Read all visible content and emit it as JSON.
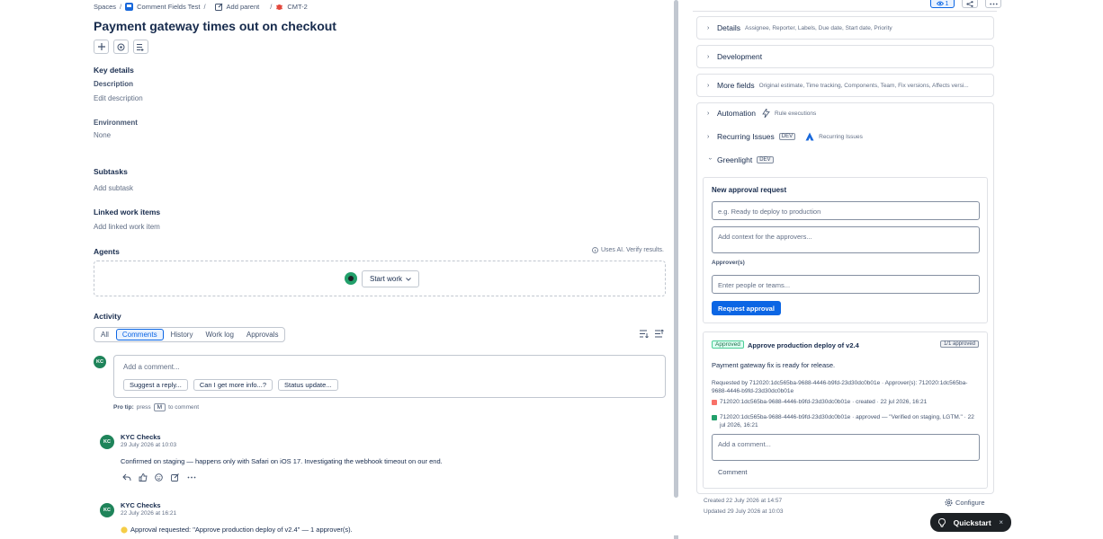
{
  "breadcrumbs": {
    "spaces": "Spaces",
    "project": "Comment Fields Test",
    "add_parent": "Add parent",
    "issue_key": "CMT-2",
    "sep": "/"
  },
  "issue": {
    "title": "Payment gateway times out on checkout"
  },
  "key_details": {
    "heading": "Key details",
    "description_label": "Description",
    "description_value": "Edit description",
    "environment_label": "Environment",
    "environment_value": "None"
  },
  "subtasks": {
    "heading": "Subtasks",
    "action": "Add subtask"
  },
  "linked": {
    "heading": "Linked work items",
    "action": "Add linked work item"
  },
  "agents": {
    "heading": "Agents",
    "ai_note": "Uses AI. Verify results.",
    "start_work": "Start work"
  },
  "activity": {
    "heading": "Activity",
    "tabs": [
      "All",
      "Comments",
      "History",
      "Work log",
      "Approvals"
    ],
    "active_tab": "Comments",
    "comment_placeholder": "Add a comment...",
    "suggestions": [
      "Suggest a reply...",
      "Can I get more info...?",
      "Status update..."
    ],
    "protip_bold": "Pro tip:",
    "protip_press": "press",
    "protip_key": "M",
    "protip_rest": "to comment",
    "current_user_initials": "KC",
    "comments": [
      {
        "initials": "KC",
        "author": "KYC Checks",
        "date": "29 July 2026 at 10:03",
        "body": "Confirmed on staging — happens only with Safari on iOS 17. Investigating the webhook timeout on our end."
      },
      {
        "initials": "KC",
        "author": "KYC Checks",
        "date": "22 July 2026 at 16:21",
        "body": "Approval requested: \"Approve production deploy of v2.4\" — 1 approver(s)."
      }
    ]
  },
  "top_actions": {
    "watch_count": "1"
  },
  "panels": {
    "details": {
      "title": "Details",
      "sub": "Assignee, Reporter, Labels, Due date, Start date, Priority"
    },
    "development": {
      "title": "Development"
    },
    "more_fields": {
      "title": "More fields",
      "sub": "Original estimate, Time tracking, Components, Team, Fix versions, Affects versi..."
    },
    "automation": {
      "title": "Automation",
      "sub": "Rule executions"
    },
    "recurring": {
      "title": "Recurring Issues",
      "badge": "DEV",
      "sub": "Recurring Issues"
    },
    "greenlight": {
      "title": "Greenlight",
      "badge": "DEV"
    }
  },
  "greenlight": {
    "new_request_heading": "New approval request",
    "title_placeholder": "e.g. Ready to deploy to production",
    "context_placeholder": "Add context for the approvers...",
    "approvers_label": "Approver(s)",
    "approvers_placeholder": "Enter people or teams...",
    "request_button": "Request approval",
    "request": {
      "status": "Approved",
      "title": "Approve production deploy of v2.4",
      "count": "1/1 approved",
      "description": "Payment gateway fix is ready for release.",
      "requested_by": "Requested by 712020:1dc565ba-9688-4446-b9fd-23d30dc0b01e · Approver(s): 712020:1dc565ba-9688-4446-b9fd-23d30dc0b01e",
      "log_created": "712020:1dc565ba-9688-4446-b9fd-23d30dc0b01e · created · 22 jul 2026, 16:21",
      "log_approved": "712020:1dc565ba-9688-4446-b9fd-23d30dc0b01e · approved — \"Verified on staging, LGTM.\" · 22 jul 2026, 16:21",
      "comment_placeholder": "Add a comment...",
      "comment_button": "Comment"
    }
  },
  "meta": {
    "created": "Created 22 July 2026 at 14:57",
    "updated": "Updated 29 July 2026 at 10:03",
    "configure": "Configure"
  },
  "quickstart": {
    "label": "Quickstart",
    "close": "×"
  },
  "colors": {
    "accent": "#0c66e4",
    "avatar": "#1f845a",
    "approved": "#216e4e"
  }
}
